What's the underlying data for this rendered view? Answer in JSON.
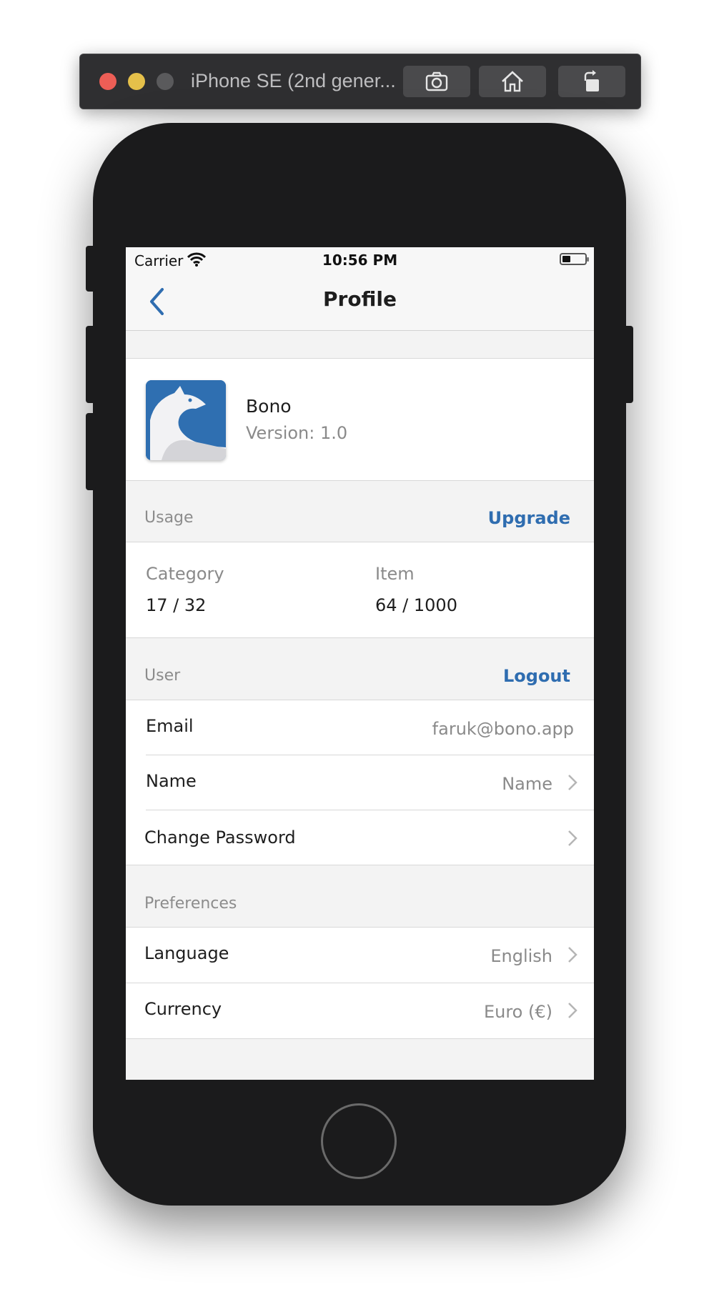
{
  "simulator": {
    "title": "iPhone SE (2nd gener...",
    "buttons": [
      "screenshot-icon",
      "home-icon",
      "rotate-icon"
    ]
  },
  "status_bar": {
    "carrier": "Carrier",
    "time": "10:56 PM"
  },
  "nav": {
    "title": "Profile"
  },
  "app_info": {
    "name": "Bono",
    "version": "Version: 1.0"
  },
  "usage": {
    "label": "Usage",
    "action": "Upgrade",
    "category_label": "Category",
    "category_value": "17 / 32",
    "item_label": "Item",
    "item_value": "64 / 1000"
  },
  "user": {
    "label": "User",
    "action": "Logout",
    "email_label": "Email",
    "email_value": "faruk@bono.app",
    "name_label": "Name",
    "name_value": "Name",
    "change_password_label": "Change Password"
  },
  "preferences": {
    "label": "Preferences",
    "language_label": "Language",
    "language_value": "English",
    "currency_label": "Currency",
    "currency_value": "Euro (€)"
  },
  "colors": {
    "accent": "#2f6db0",
    "icon_bg": "#2f6fb1"
  }
}
